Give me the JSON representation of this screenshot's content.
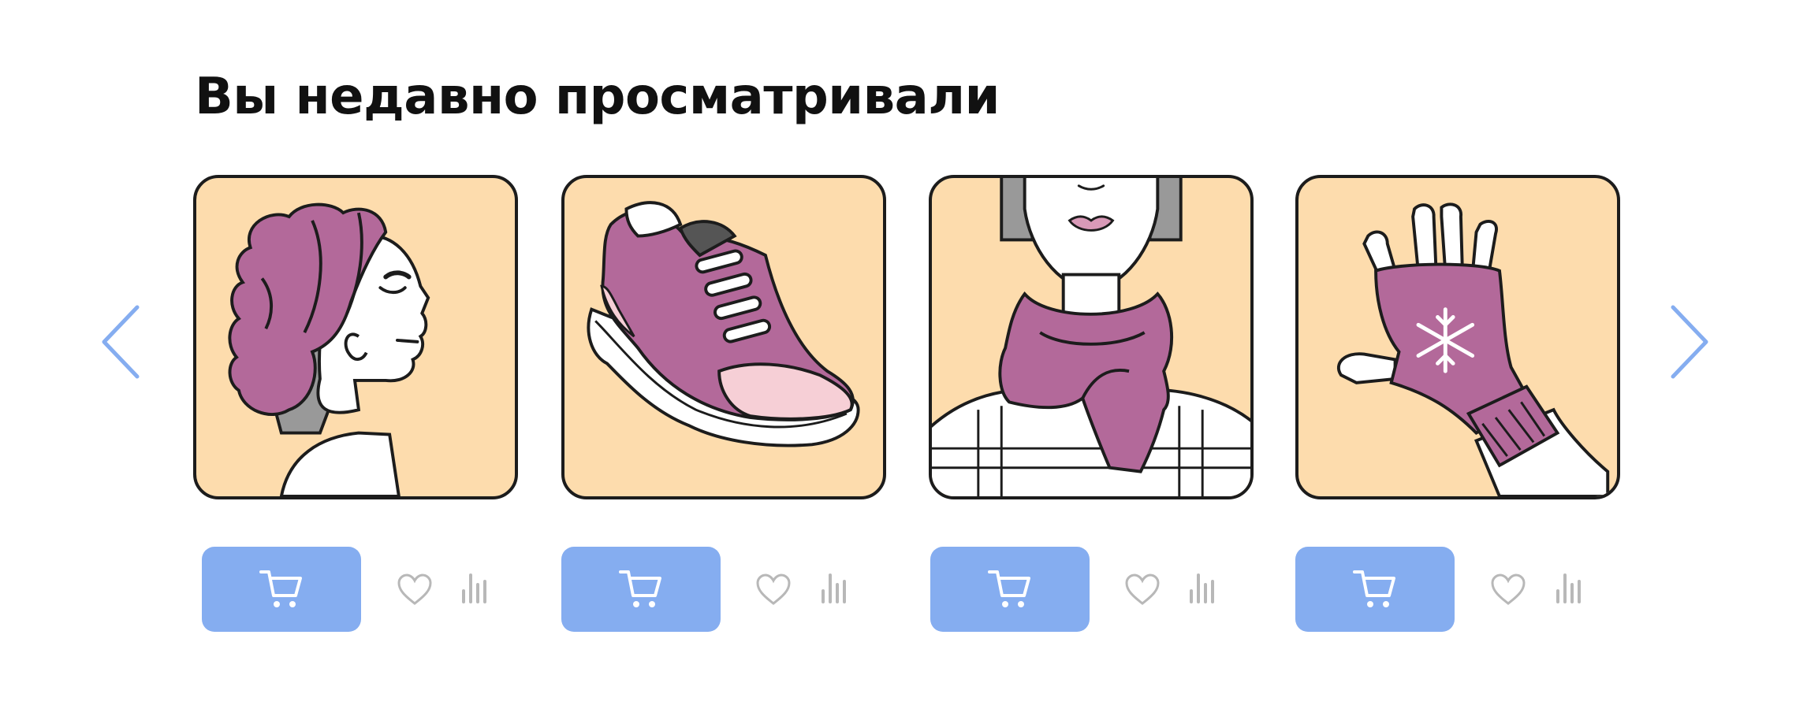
{
  "section": {
    "title": "Вы недавно просматривали"
  },
  "colors": {
    "card_background": "#fddcad",
    "cart_button": "#85adf0",
    "arrow": "#85adf0",
    "accent_purple": "#b3699a",
    "icon_gray": "#b8b8b8"
  },
  "carousel": {
    "prev_icon": "chevron-left-icon",
    "next_icon": "chevron-right-icon"
  },
  "products": [
    {
      "image": "hair-wrap-illustration",
      "actions": [
        "cart-icon",
        "heart-icon",
        "compare-icon"
      ]
    },
    {
      "image": "sneaker-illustration",
      "actions": [
        "cart-icon",
        "heart-icon",
        "compare-icon"
      ]
    },
    {
      "image": "scarf-illustration",
      "actions": [
        "cart-icon",
        "heart-icon",
        "compare-icon"
      ]
    },
    {
      "image": "fingerless-glove-illustration",
      "actions": [
        "cart-icon",
        "heart-icon",
        "compare-icon"
      ]
    }
  ]
}
